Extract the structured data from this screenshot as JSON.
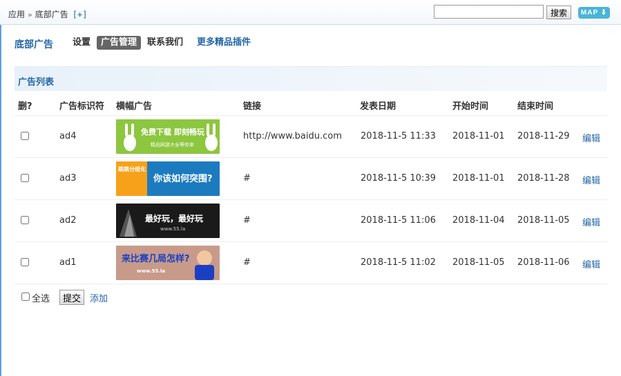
{
  "header": {
    "breadcrumb": [
      "应用",
      "底部广告"
    ],
    "breadcrumb_sep": "»",
    "add_icon": "[+]",
    "search_value": "",
    "search_button": "搜索",
    "map_button": "MAP ⬇"
  },
  "plugin": {
    "title": "底部广告",
    "nav": [
      {
        "label": "设置",
        "active": false
      },
      {
        "label": "广告管理",
        "active": true
      },
      {
        "label": "联系我们",
        "active": false
      },
      {
        "label": "更多精品插件",
        "active": false
      }
    ]
  },
  "section": {
    "title": "广告列表"
  },
  "table": {
    "headers": [
      "删?",
      "广告标识符",
      "横幅广告",
      "链接",
      "发表日期",
      "开始时间",
      "结束时间"
    ],
    "rows": [
      {
        "id": "ad4",
        "link": "http://www.baidu.com",
        "posted": "2018-11-5 11:33",
        "start": "2018-11-01",
        "end": "2018-11-29",
        "edit": "编辑",
        "banner": {
          "bg": "#8dc63f",
          "accent": "#ffffff",
          "text1": "免费下载 即刻畅玩",
          "text2": "精品网游大全等你来"
        }
      },
      {
        "id": "ad3",
        "link": "#",
        "posted": "2018-11-5 10:39",
        "start": "2018-11-01",
        "end": "2018-11-28",
        "edit": "编辑",
        "banner": {
          "bg": "#1c7bbf",
          "accent": "#f7a11a",
          "text1": "你该如何突围?",
          "text2": "跳跳分组化"
        }
      },
      {
        "id": "ad2",
        "link": "#",
        "posted": "2018-11-5 11:06",
        "start": "2018-11-04",
        "end": "2018-11-05",
        "edit": "编辑",
        "banner": {
          "bg": "#1a1a1a",
          "accent": "#ffffff",
          "text1": "最好玩，最好玩",
          "text2": "www.55.la"
        }
      },
      {
        "id": "ad1",
        "link": "#",
        "posted": "2018-11-5 11:02",
        "start": "2018-11-05",
        "end": "2018-11-06",
        "edit": "编辑",
        "banner": {
          "bg": "#c89a8a",
          "accent": "#1a3fc4",
          "text1": "来比赛几局怎样?",
          "text2": "www.55.la"
        }
      }
    ]
  },
  "footer": {
    "select_all": "全选",
    "submit": "提交",
    "add": "添加"
  }
}
